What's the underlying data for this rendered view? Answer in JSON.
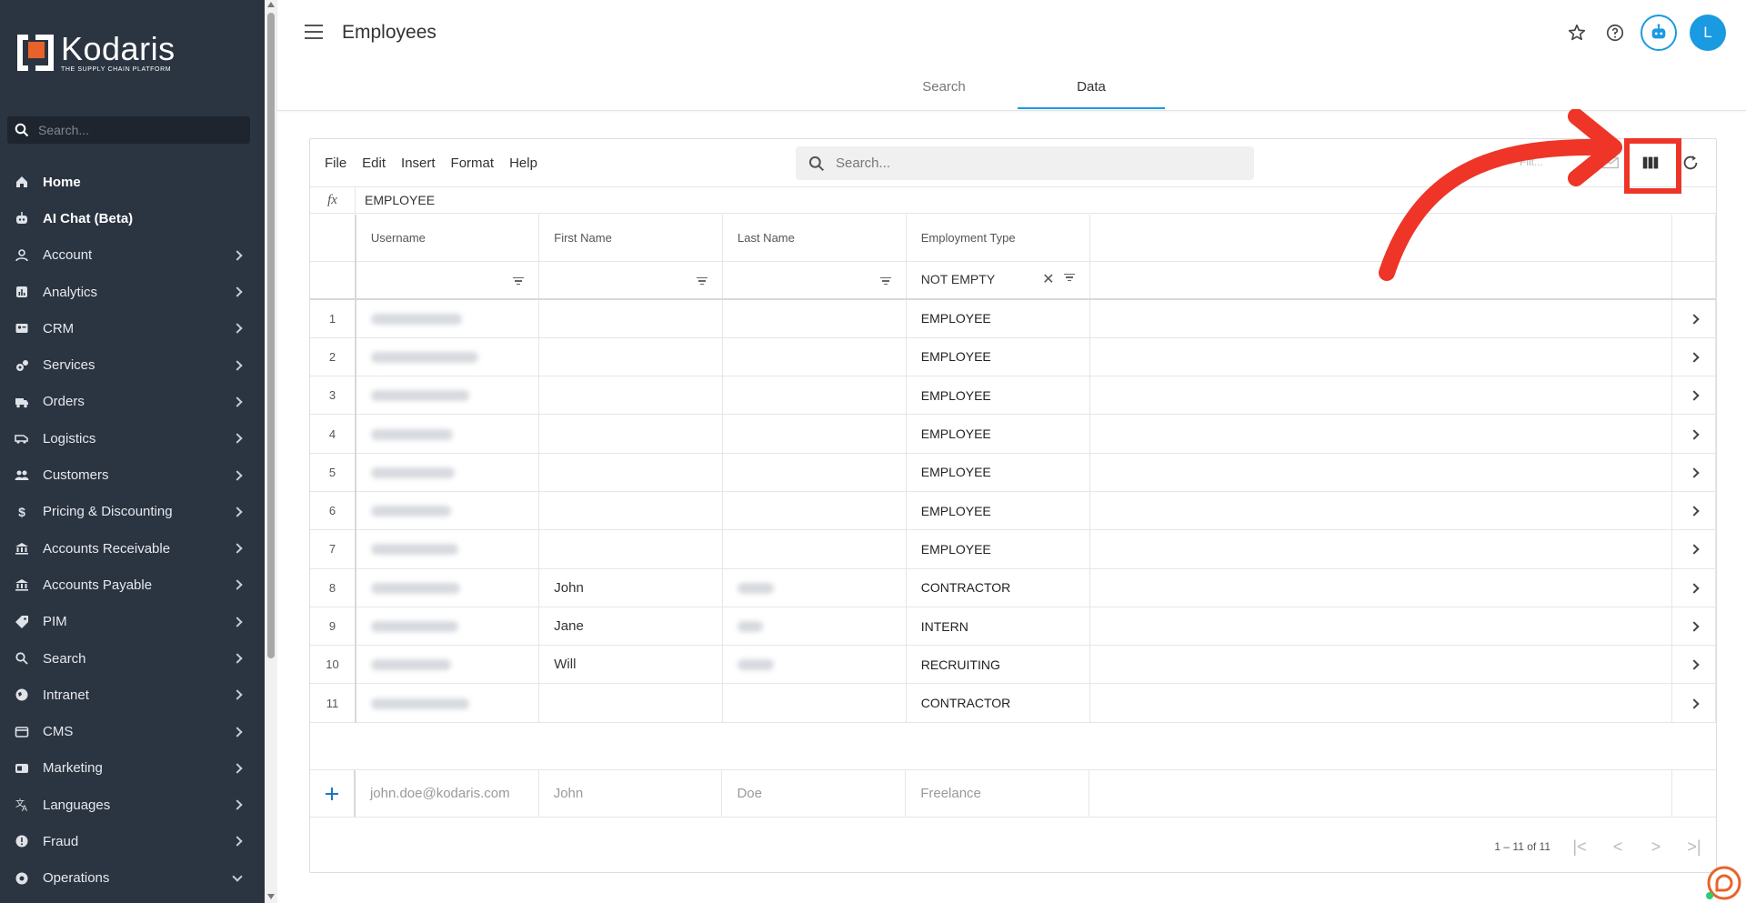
{
  "app": {
    "brand": "Kodaris",
    "tagline": "THE SUPPLY CHAIN PLATFORM",
    "accent": "#1a9ae0",
    "sidebar_bg": "#2b3441"
  },
  "sidebar": {
    "search_placeholder": "Search...",
    "items": [
      {
        "label": "Home",
        "icon": "home-icon",
        "bold": true,
        "expand": false
      },
      {
        "label": "AI Chat (Beta)",
        "icon": "robot-icon",
        "bold": true,
        "expand": false
      },
      {
        "label": "Account",
        "icon": "person-icon",
        "expand": true
      },
      {
        "label": "Analytics",
        "icon": "chart-icon",
        "expand": true
      },
      {
        "label": "CRM",
        "icon": "contact-card-icon",
        "expand": true
      },
      {
        "label": "Services",
        "icon": "gears-icon",
        "expand": true
      },
      {
        "label": "Orders",
        "icon": "truck-icon",
        "expand": true
      },
      {
        "label": "Logistics",
        "icon": "van-icon",
        "expand": true
      },
      {
        "label": "Customers",
        "icon": "people-icon",
        "expand": true
      },
      {
        "label": "Pricing & Discounting",
        "icon": "dollar-icon",
        "expand": true
      },
      {
        "label": "Accounts Receivable",
        "icon": "bank-icon",
        "expand": true
      },
      {
        "label": "Accounts Payable",
        "icon": "bank-icon",
        "expand": true
      },
      {
        "label": "PIM",
        "icon": "tag-icon",
        "expand": true
      },
      {
        "label": "Search",
        "icon": "search-icon",
        "expand": true
      },
      {
        "label": "Intranet",
        "icon": "globe-icon",
        "expand": true
      },
      {
        "label": "CMS",
        "icon": "browser-icon",
        "expand": true
      },
      {
        "label": "Marketing",
        "icon": "megaphone-icon",
        "expand": true
      },
      {
        "label": "Languages",
        "icon": "translate-icon",
        "expand": true
      },
      {
        "label": "Fraud",
        "icon": "alert-icon",
        "expand": true
      },
      {
        "label": "Operations",
        "icon": "ops-icon",
        "expand": true,
        "open": true
      }
    ]
  },
  "header": {
    "title": "Employees",
    "avatar_letter": "L"
  },
  "tabs": [
    {
      "label": "Search",
      "active": false
    },
    {
      "label": "Data",
      "active": true
    }
  ],
  "toolbar": {
    "menu": [
      "File",
      "Edit",
      "Insert",
      "Format",
      "Help"
    ],
    "search_placeholder": "Search...",
    "filter_label": "Filt..."
  },
  "formula": {
    "fx": "fx",
    "value": "EMPLOYEE"
  },
  "columns": [
    "Username",
    "First Name",
    "Last Name",
    "Employment Type"
  ],
  "filters": {
    "employment_type": "NOT EMPTY"
  },
  "rows": [
    {
      "num": "1",
      "first": "",
      "last": "",
      "type": "EMPLOYEE"
    },
    {
      "num": "2",
      "first": "",
      "last": "",
      "type": "EMPLOYEE"
    },
    {
      "num": "3",
      "first": "",
      "last": "",
      "type": "EMPLOYEE"
    },
    {
      "num": "4",
      "first": "",
      "last": "",
      "type": "EMPLOYEE"
    },
    {
      "num": "5",
      "first": "",
      "last": "",
      "type": "EMPLOYEE"
    },
    {
      "num": "6",
      "first": "",
      "last": "",
      "type": "EMPLOYEE"
    },
    {
      "num": "7",
      "first": "",
      "last": "",
      "type": "EMPLOYEE"
    },
    {
      "num": "8",
      "first": "John",
      "last": "",
      "type": "CONTRACTOR"
    },
    {
      "num": "9",
      "first": "Jane",
      "last": "",
      "type": "INTERN"
    },
    {
      "num": "10",
      "first": "Will",
      "last": "",
      "type": "RECRUITING"
    },
    {
      "num": "11",
      "first": "",
      "last": "",
      "type": "CONTRACTOR"
    }
  ],
  "new_row": {
    "username": "john.doe@kodaris.com",
    "first": "John",
    "last": "Doe",
    "type": "Freelance"
  },
  "pager": {
    "range": "1 – 11 of 11"
  },
  "annotation_color": "#ee3528"
}
